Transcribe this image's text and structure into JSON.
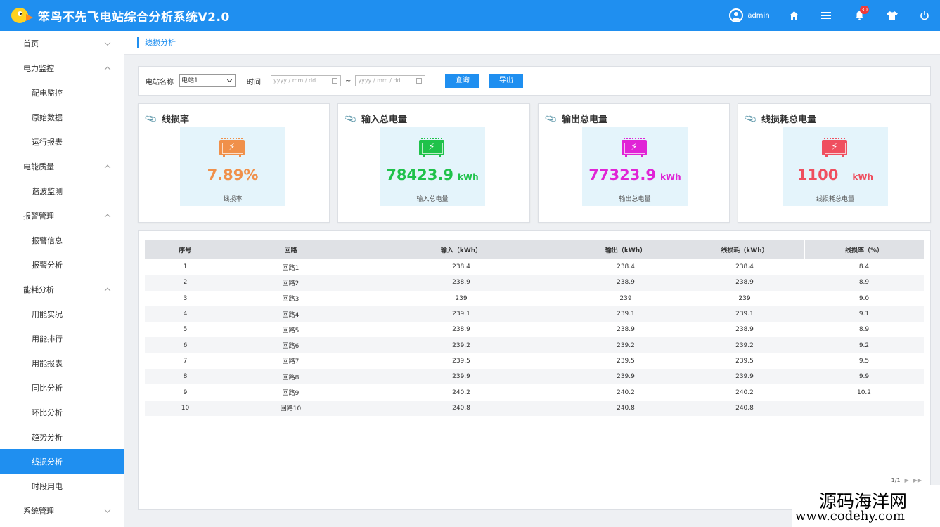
{
  "header": {
    "title": "笨鸟不先飞电站综合分析系统V2.0",
    "username": "admin",
    "notification_count": "30",
    "bg_color": "#1f8ff0"
  },
  "sidebar": {
    "items": [
      {
        "label": "首页",
        "level": "group",
        "chevron": "down"
      },
      {
        "label": "电力监控",
        "level": "group",
        "chevron": "up"
      },
      {
        "label": "配电监控",
        "level": "sub"
      },
      {
        "label": "原始数据",
        "level": "sub"
      },
      {
        "label": "运行报表",
        "level": "sub"
      },
      {
        "label": "电能质量",
        "level": "group",
        "chevron": "up"
      },
      {
        "label": "谐波监测",
        "level": "sub"
      },
      {
        "label": "报警管理",
        "level": "group",
        "chevron": "up"
      },
      {
        "label": "报警信息",
        "level": "sub"
      },
      {
        "label": "报警分析",
        "level": "sub"
      },
      {
        "label": "能耗分析",
        "level": "group",
        "chevron": "up"
      },
      {
        "label": "用能实况",
        "level": "sub"
      },
      {
        "label": "用能排行",
        "level": "sub"
      },
      {
        "label": "用能报表",
        "level": "sub"
      },
      {
        "label": "同比分析",
        "level": "sub"
      },
      {
        "label": "环比分析",
        "level": "sub"
      },
      {
        "label": "趋势分析",
        "level": "sub"
      },
      {
        "label": "线损分析",
        "level": "sub",
        "active": true
      },
      {
        "label": "时段用电",
        "level": "sub"
      },
      {
        "label": "系统管理",
        "level": "group",
        "chevron": "down"
      }
    ]
  },
  "breadcrumb": "线损分析",
  "filter": {
    "station_label": "电站名称",
    "station_value": "电站1",
    "time_label": "时间",
    "date_placeholder": "yyyy / mm / dd",
    "separator": "~",
    "query_button": "查询",
    "export_button": "导出"
  },
  "stats": [
    {
      "title": "线损率",
      "value": "7.89%",
      "unit": "",
      "caption": "线损率",
      "color": "#f0904a"
    },
    {
      "title": "输入总电量",
      "value": "78423.9",
      "unit": "kWh",
      "caption": "输入总电量",
      "color": "#1fc24a"
    },
    {
      "title": "输出总电量",
      "value": "77323.9",
      "unit": "kWh",
      "caption": "输出总电量",
      "color": "#e024d6"
    },
    {
      "title": "线损耗总电量",
      "value": "1100",
      "unit": "kWh",
      "caption": "线损耗总电量",
      "color": "#ef4f5f"
    }
  ],
  "table": {
    "columns": [
      "序号",
      "回路",
      "输入（kWh）",
      "输出（kWh）",
      "线损耗（kWh）",
      "线损率（%）"
    ],
    "rows": [
      [
        "1",
        "回路1",
        "238.4",
        "238.4",
        "238.4",
        "8.4"
      ],
      [
        "2",
        "回路2",
        "238.9",
        "238.9",
        "238.9",
        "8.9"
      ],
      [
        "3",
        "回路3",
        "239",
        "239",
        "239",
        "9.0"
      ],
      [
        "4",
        "回路4",
        "239.1",
        "239.1",
        "239.1",
        "9.1"
      ],
      [
        "5",
        "回路5",
        "238.9",
        "238.9",
        "238.9",
        "8.9"
      ],
      [
        "6",
        "回路6",
        "239.2",
        "239.2",
        "239.2",
        "9.2"
      ],
      [
        "7",
        "回路7",
        "239.5",
        "239.5",
        "239.5",
        "9.5"
      ],
      [
        "8",
        "回路8",
        "239.9",
        "239.9",
        "239.9",
        "9.9"
      ],
      [
        "9",
        "回路9",
        "240.2",
        "240.2",
        "240.2",
        "10.2"
      ],
      [
        "10",
        "回路10",
        "240.8",
        "240.8",
        "240.8",
        ""
      ]
    ]
  },
  "pager": {
    "text": "1/1"
  },
  "watermark": {
    "line1": "源码海洋网",
    "line2": "www.codehy.com"
  }
}
